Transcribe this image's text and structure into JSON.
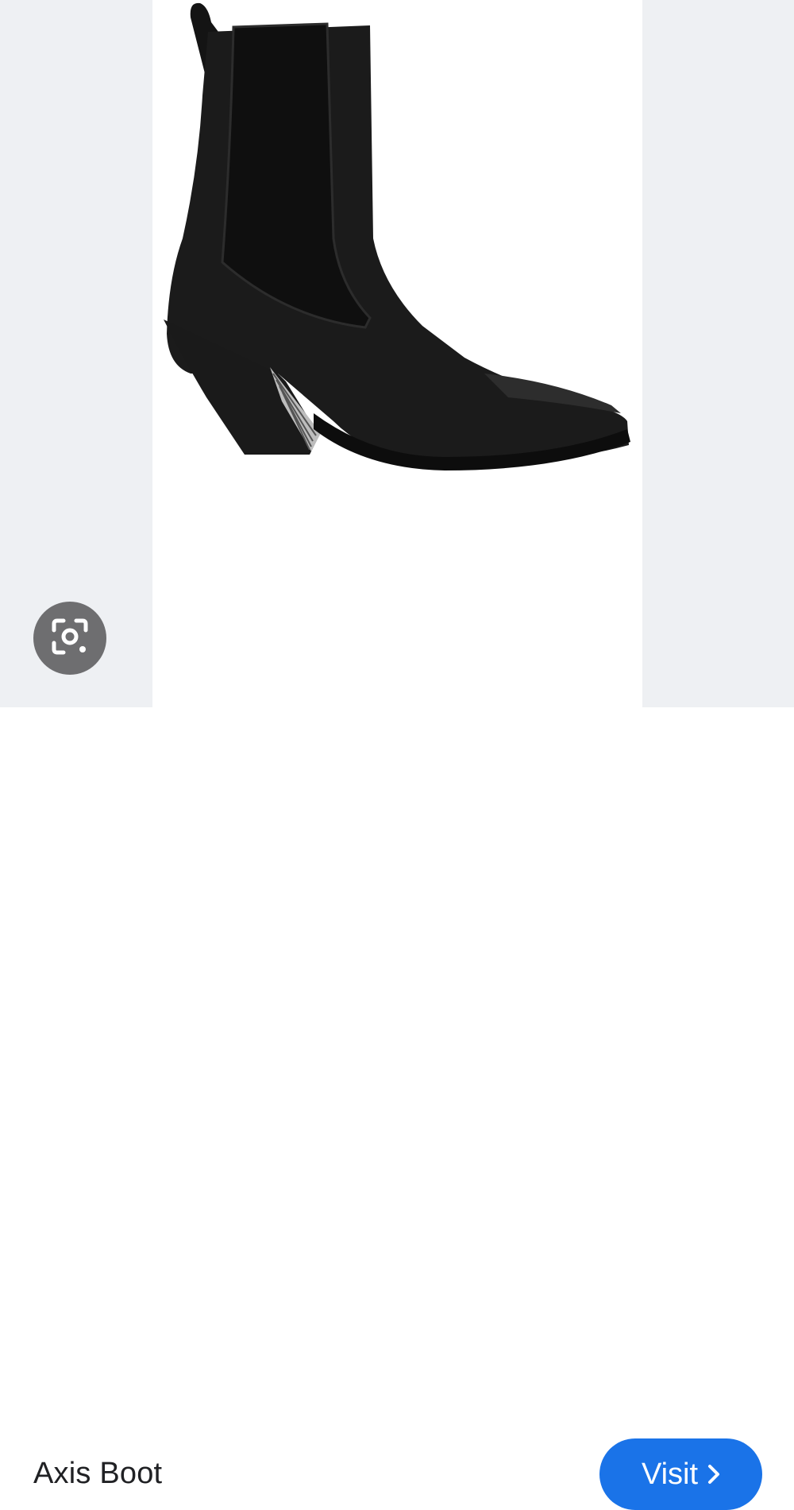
{
  "product": {
    "title": "Axis Boot"
  },
  "actions": {
    "visit_label": "Visit",
    "visit_icon": "chevron-right-icon",
    "lens_icon": "camera-lens-icon"
  },
  "colors": {
    "viewer_background": "#eef0f3",
    "visit_button": "#1a73e8",
    "lens_button": "#6e6e70"
  }
}
